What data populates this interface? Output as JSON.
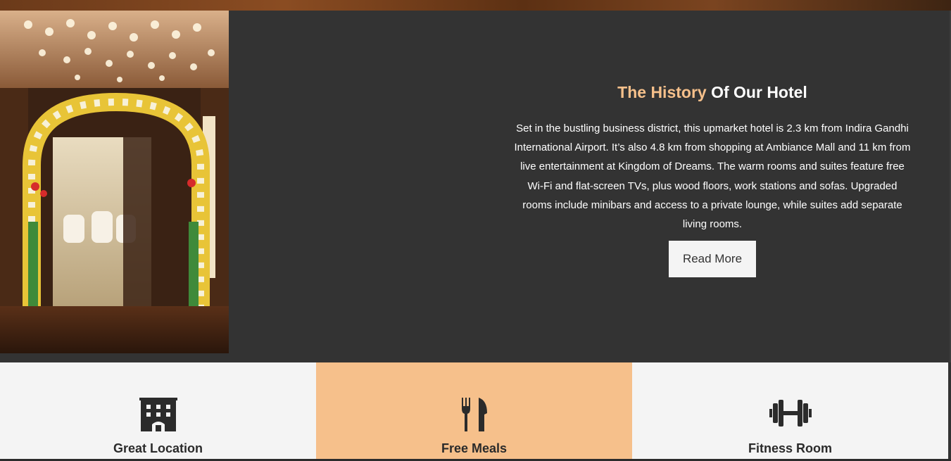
{
  "history": {
    "title_accent": "The History",
    "title_rest": "Of Our Hotel",
    "body": "Set in the bustling business district, this upmarket hotel is 2.3 km from Indira Gandhi International Airport. It’s also 4.8 km from shopping at Ambiance Mall and 11 km from live entertainment at Kingdom of Dreams. The warm rooms and suites feature free Wi-Fi and flat-screen TVs, plus wood floors, work stations and sofas. Upgraded rooms include minibars and access to a private lounge, while suites add separate living rooms.",
    "read_more_label": "Read More"
  },
  "features": [
    {
      "label": "Great Location",
      "icon": "building-icon"
    },
    {
      "label": "Free Meals",
      "icon": "utensils-icon"
    },
    {
      "label": "Fitness Room",
      "icon": "dumbbell-icon"
    }
  ],
  "colors": {
    "accent": "#f6c08b",
    "dark_bg": "#333333",
    "light_bg": "#f4f4f4",
    "icon": "#2b2b2b"
  }
}
